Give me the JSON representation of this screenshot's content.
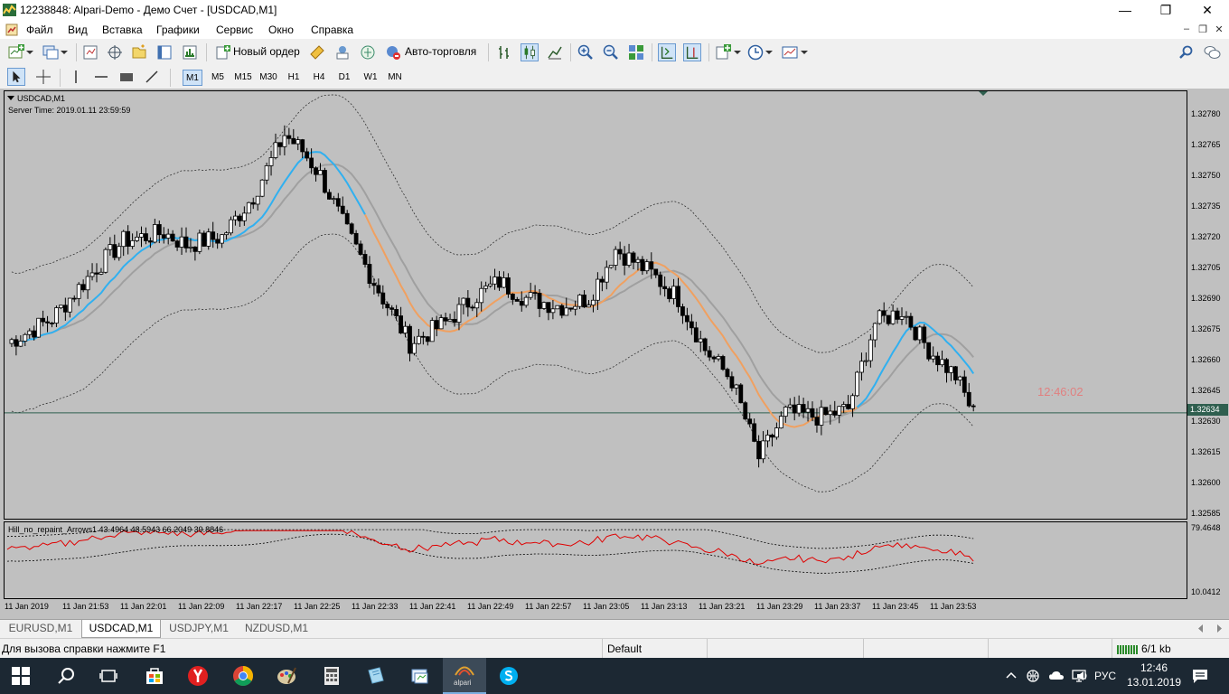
{
  "window": {
    "title": "12238848: Alpari-Demo - Демо Счет - [USDCAD,M1]",
    "minimize": "—",
    "maximize": "❐",
    "close": "✕"
  },
  "menu": {
    "items": [
      "Файл",
      "Вид",
      "Вставка",
      "Графики",
      "Сервис",
      "Окно",
      "Справка"
    ]
  },
  "toolbar": {
    "new_order": "Новый ордер",
    "auto_trading": "Авто-торговля",
    "timeframes": [
      "M1",
      "M5",
      "M15",
      "M30",
      "H1",
      "H4",
      "D1",
      "W1",
      "MN"
    ],
    "active_timeframe": "M1"
  },
  "chart": {
    "symbol_label": "USDCAD,M1",
    "server_time": "Server Time: 2019.01.11 23:59:59",
    "countdown": "12:46:02",
    "current_price": "1.32634",
    "price_labels": [
      "1.32780",
      "1.32765",
      "1.32750",
      "1.32735",
      "1.32720",
      "1.32705",
      "1.32690",
      "1.32675",
      "1.32660",
      "1.32645",
      "1.32630",
      "1.32615",
      "1.32600",
      "1.32585"
    ],
    "indicator_label": "Hill_no_repaint_Arrows1 43.4964 48.5943 66.2049 39.8846",
    "indicator_max": "79.4648",
    "indicator_min": "10.0412",
    "time_labels": [
      "11 Jan 2019",
      "11 Jan 21:53",
      "11 Jan 22:01",
      "11 Jan 22:09",
      "11 Jan 22:17",
      "11 Jan 22:25",
      "11 Jan 22:33",
      "11 Jan 22:41",
      "11 Jan 22:49",
      "11 Jan 22:57",
      "11 Jan 23:05",
      "11 Jan 23:13",
      "11 Jan 23:21",
      "11 Jan 23:29",
      "11 Jan 23:37",
      "11 Jan 23:45",
      "11 Jan 23:53"
    ],
    "colors": {
      "background": "#c0c0c0",
      "bull_candle": "#ffffff",
      "bear_candle": "#000000",
      "ma_blue": "#30b0f0",
      "ma_orange": "#f0a060",
      "ma_gray": "#a0a0a0",
      "indicator_line": "#e00000",
      "countdown": "#e08080",
      "price_line": "#2f5f4f"
    }
  },
  "tabs": {
    "items": [
      "EURUSD,M1",
      "USDCAD,M1",
      "USDJPY,M1",
      "NZDUSD,M1"
    ],
    "active": "USDCAD,M1"
  },
  "status": {
    "help": "Для вызова справки нажмите F1",
    "profile": "Default",
    "traffic": "6/1 kb"
  },
  "taskbar": {
    "language": "РУС",
    "time": "12:46",
    "date": "13.01.2019",
    "alpari_label": "alpari"
  }
}
